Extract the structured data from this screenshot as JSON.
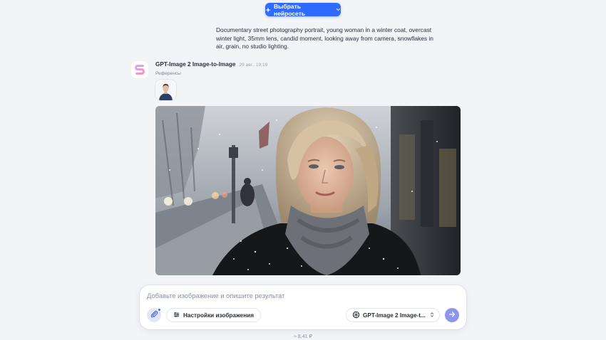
{
  "header": {
    "select_model_label": "Выбрать нейросеть"
  },
  "user_message": {
    "text": "Documentary street photography portrait, young woman in a winter coat, overcast winter light, 35mm lens, candid moment, looking away from camera, snowflakes in air, grain, no studio lighting."
  },
  "assistant_message": {
    "model_name": "GPT-Image 2 Image-to-Image",
    "timestamp": "29 авг., 19:19",
    "references_label": "Референсы"
  },
  "composer": {
    "placeholder": "Добавьте изображение и опишите результат",
    "settings_label": "Настройки изображения",
    "model_label": "GPT-Image 2 Image-t..."
  },
  "price": "≈ 8,41 ₽",
  "colors": {
    "accent": "#2f6bff",
    "send_button": "#8f94ef",
    "background": "#f3f4f8"
  },
  "icons": [
    "sparkle-icon",
    "chevron-down-icon",
    "app-logo-icon",
    "paperclip-icon",
    "sliders-icon",
    "openai-icon",
    "chevron-updown-icon",
    "arrow-right-icon"
  ]
}
